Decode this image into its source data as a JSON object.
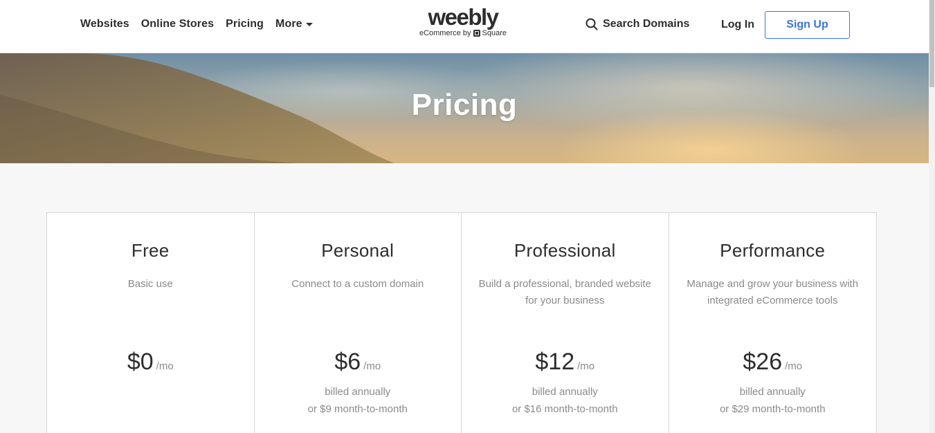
{
  "nav": {
    "items": [
      {
        "label": "Websites"
      },
      {
        "label": "Online Stores"
      },
      {
        "label": "Pricing"
      },
      {
        "label": "More"
      }
    ],
    "more_icon": "caret-down-icon"
  },
  "logo": {
    "wordmark": "weebly",
    "tagline_prefix": "eCommerce by",
    "tagline_brand": "Square"
  },
  "header": {
    "search_icon": "search-icon",
    "search_label": "Search Domains",
    "login_label": "Log In",
    "signup_label": "Sign Up",
    "accent_color": "#3b74d9"
  },
  "hero": {
    "title": "Pricing"
  },
  "plans": [
    {
      "name": "Free",
      "description": "Basic use",
      "price": "$0",
      "unit": "/mo",
      "billing_line1": "",
      "billing_line2": ""
    },
    {
      "name": "Personal",
      "description": "Connect to a custom domain",
      "price": "$6",
      "unit": "/mo",
      "billing_line1": "billed annually",
      "billing_line2": "or $9 month-to-month"
    },
    {
      "name": "Professional",
      "description": "Build a professional, branded website for your business",
      "price": "$12",
      "unit": "/mo",
      "billing_line1": "billed annually",
      "billing_line2": "or $16 month-to-month"
    },
    {
      "name": "Performance",
      "description": "Manage and grow your business with integrated eCommerce tools",
      "price": "$26",
      "unit": "/mo",
      "billing_line1": "billed annually",
      "billing_line2": "or $29 month-to-month"
    }
  ]
}
